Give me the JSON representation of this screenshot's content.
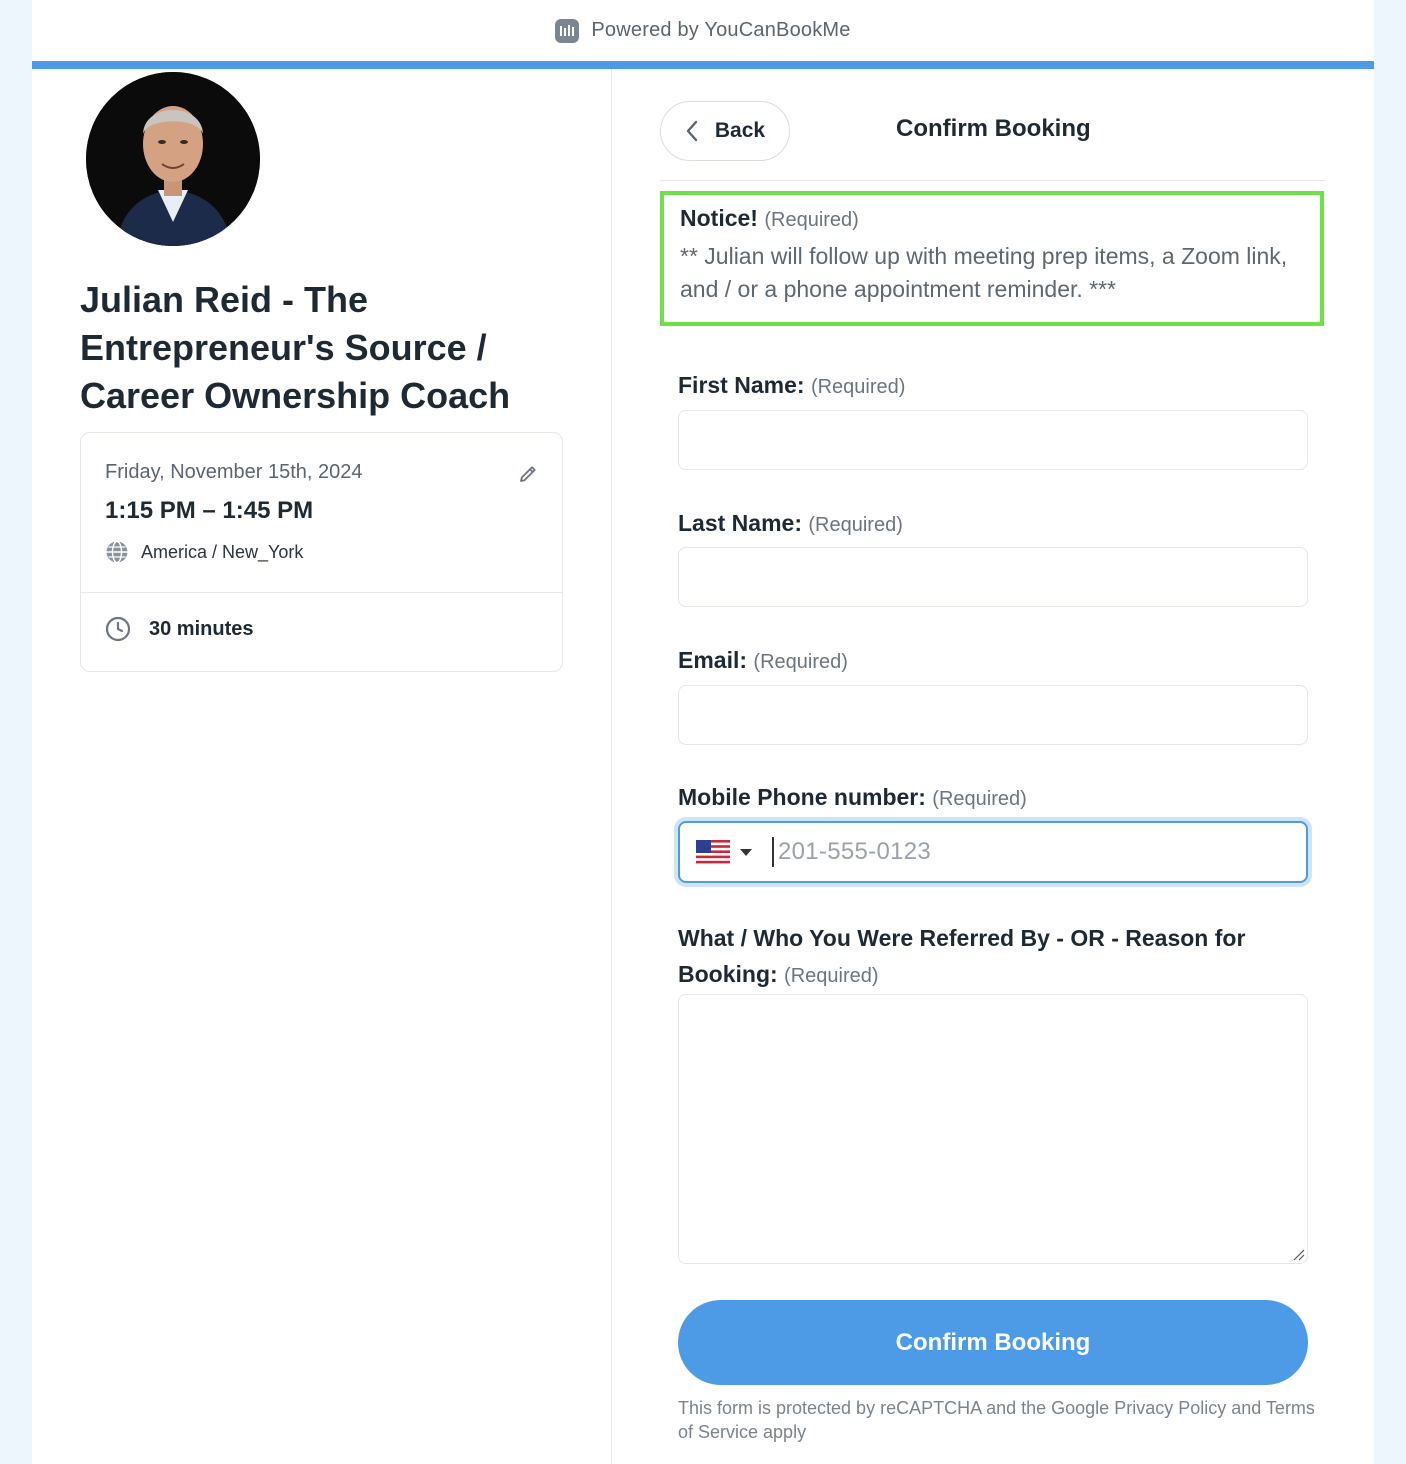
{
  "header": {
    "powered_by": "Powered by YouCanBookMe"
  },
  "profile": {
    "name": "Julian Reid - The Entrepreneur's Source / Career Ownership Coach"
  },
  "booking": {
    "date": "Friday, November 15th, 2024",
    "time": "1:15 PM – 1:45 PM",
    "timezone": "America / New_York",
    "duration": "30 minutes"
  },
  "form": {
    "back_label": "Back",
    "title": "Confirm Booking",
    "notice": {
      "heading": "Notice!",
      "required": "(Required)",
      "body": "** Julian will follow up with meeting prep items, a Zoom link, and / or a phone appointment reminder. ***"
    },
    "fields": {
      "first_name": {
        "label": "First Name:",
        "required": "(Required)",
        "value": ""
      },
      "last_name": {
        "label": "Last Name:",
        "required": "(Required)",
        "value": ""
      },
      "email": {
        "label": "Email:",
        "required": "(Required)",
        "value": ""
      },
      "phone": {
        "label": "Mobile Phone number:",
        "required": "(Required)",
        "placeholder": "201-555-0123",
        "country": "US"
      },
      "referral": {
        "label": "What / Who You Were Referred By - OR - Reason for Booking:",
        "required": "(Required)",
        "value": ""
      }
    },
    "submit_label": "Confirm Booking",
    "recaptcha_text": "This form is protected by reCAPTCHA and the Google Privacy Policy and Terms of Service apply"
  },
  "colors": {
    "accent": "#4d9be6",
    "notice_border": "#6de04a"
  }
}
